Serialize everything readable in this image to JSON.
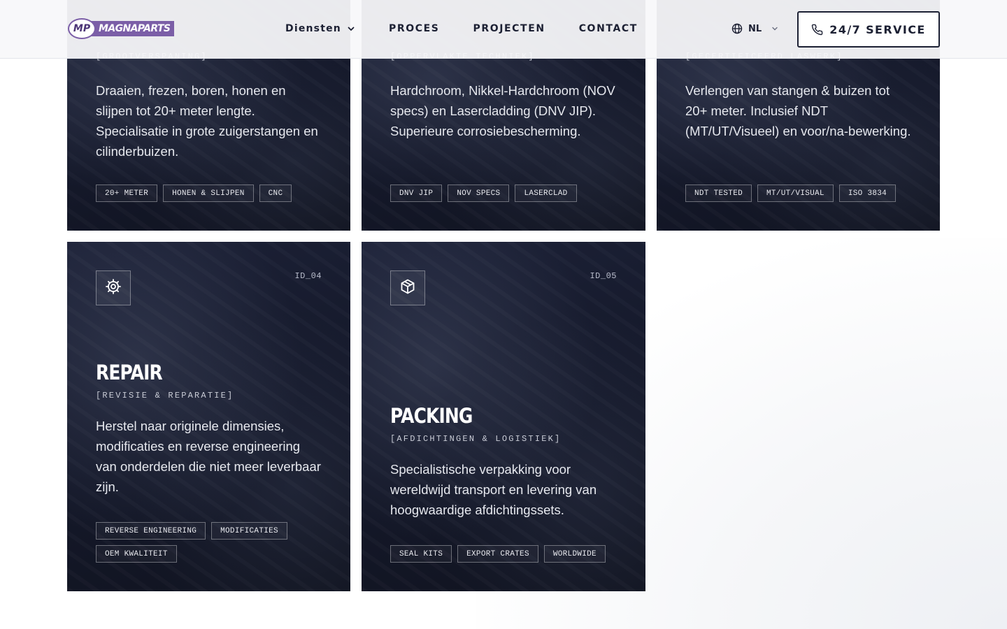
{
  "header": {
    "logo_mark": "MP",
    "logo_text": "MAGNAPARTS",
    "nav": [
      {
        "label": "Diensten",
        "dropdown": true
      },
      {
        "label": "PROCES"
      },
      {
        "label": "PROJECTEN"
      },
      {
        "label": "CONTACT"
      }
    ],
    "language": "NL",
    "service_button": "24/7 SERVICE",
    "icons": {
      "nav_dropdown": "chevron-down-icon",
      "language": "globe-icon",
      "service": "phone-icon"
    }
  },
  "cards": [
    {
      "subtitle": "[GROOTVERSPANING]",
      "description": "Draaien, frezen, boren, honen en slijpen tot 20+ meter lengte. Specialisatie in grote zuigerstangen en cilinderbuizen.",
      "tags": [
        "20+ METER",
        "HONEN & SLIJPEN",
        "CNC"
      ]
    },
    {
      "subtitle": "[OPPERVLAKTE TECHNIEK]",
      "description": "Hardchroom, Nikkel-Hardchroom (NOV specs) en Lasercladding (DNV JIP). Superieure corrosiebescherming.",
      "tags": [
        "DNV JIP",
        "NOV SPECS",
        "LASERCLAD"
      ]
    },
    {
      "subtitle": "[GECERTIFICEERD LASWERK]",
      "description": "Verlengen van stangen & buizen tot 20+ meter. Inclusief NDT (MT/UT/Visueel) en voor/na-bewerking.",
      "tags": [
        "NDT TESTED",
        "MT/UT/VISUAL",
        "ISO 3834"
      ]
    },
    {
      "id": "ID_04",
      "icon": "gear-icon",
      "title": "REPAIR",
      "subtitle": "[REVISIE & REPARATIE]",
      "description": "Herstel naar originele dimensies, modificaties en reverse engineering van onderdelen die niet meer leverbaar zijn.",
      "tags": [
        "REVERSE ENGINEERING",
        "MODIFICATIES",
        "OEM KWALITEIT"
      ]
    },
    {
      "id": "ID_05",
      "icon": "box-icon",
      "title": "PACKING",
      "subtitle": "[AFDICHTINGEN & LOGISTIEK]",
      "description": "Specialistische verpakking voor wereldwijd transport en levering van hoogwaardige afdichtingssets.",
      "tags": [
        "SEAL KITS",
        "EXPORT CRATES",
        "WORLDWIDE"
      ]
    }
  ],
  "colors": {
    "card_bg": "#161a2e",
    "text_dark": "#1c2033",
    "logo_purple": "#7b5ea7"
  }
}
